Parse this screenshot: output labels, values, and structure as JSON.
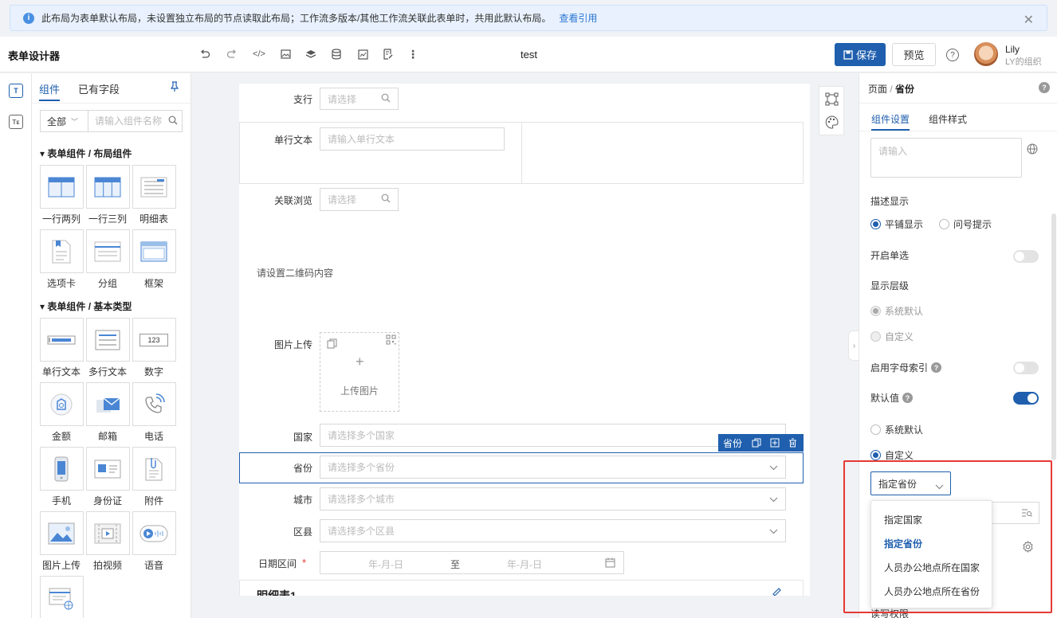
{
  "notice": {
    "text": "此布局为表单默认布局，未设置独立布局的节点读取此布局；工作流多版本/其他工作流关联此表单时，共用此默认布局。",
    "link": "查看引用"
  },
  "header": {
    "title": "表单设计器",
    "doc_name": "test",
    "save": "保存",
    "preview": "预览",
    "user_name": "Lily",
    "user_org": "LY的组织"
  },
  "left_panel": {
    "tabs": [
      "组件",
      "已有字段"
    ],
    "filter": "全部",
    "search_placeholder": "请输入组件名称",
    "section1": "表单组件 / 布局组件",
    "layout_items": [
      "一行两列",
      "一行三列",
      "明细表",
      "选项卡",
      "分组",
      "框架"
    ],
    "section2": "表单组件 / 基本类型",
    "basic_items": [
      "单行文本",
      "多行文本",
      "数字",
      "金额",
      "邮箱",
      "电话",
      "手机",
      "身份证",
      "附件",
      "图片上传",
      "拍视频",
      "语音"
    ],
    "number_glyph": "123"
  },
  "canvas": {
    "branch_label": "支行",
    "branch_ph": "请选择",
    "single_label": "单行文本",
    "single_ph": "请输入单行文本",
    "related_label": "关联浏览",
    "related_ph": "请选择",
    "qr_text": "请设置二维码内容",
    "image_label": "图片上传",
    "image_upload": "上传图片",
    "country_label": "国家",
    "country_ph": "请选择多个国家",
    "province_label": "省份",
    "province_ph": "请选择多个省份",
    "province_chip": "省份",
    "city_label": "城市",
    "city_ph": "请选择多个城市",
    "district_label": "区县",
    "district_ph": "请选择多个区县",
    "date_label": "日期区间",
    "date_start": "年-月-日",
    "date_to": "至",
    "date_end": "年-月-日",
    "detail_table": "明细表1"
  },
  "right_panel": {
    "breadcrumb_page": "页面",
    "breadcrumb_sep": "/",
    "breadcrumb_current": "省份",
    "tabs": [
      "组件设置",
      "组件样式"
    ],
    "desc_placeholder": "请输入",
    "desc_display": "描述显示",
    "desc_options": [
      "平铺显示",
      "问号提示"
    ],
    "single_select": "开启单选",
    "display_level": "显示层级",
    "level_options": [
      "系统默认",
      "自定义"
    ],
    "letter_index": "启用字母索引",
    "default_value": "默认值",
    "default_options": [
      "系统默认",
      "自定义"
    ],
    "specify_select": "指定省份",
    "dropdown_options": [
      "指定国家",
      "指定省份",
      "人员办公地点所在国家",
      "人员办公地点所在省份"
    ],
    "bottom_cut": "读写权限"
  },
  "colors": {
    "primary": "#1f5fae",
    "highlight": "#e53935",
    "required": "#e53935"
  }
}
